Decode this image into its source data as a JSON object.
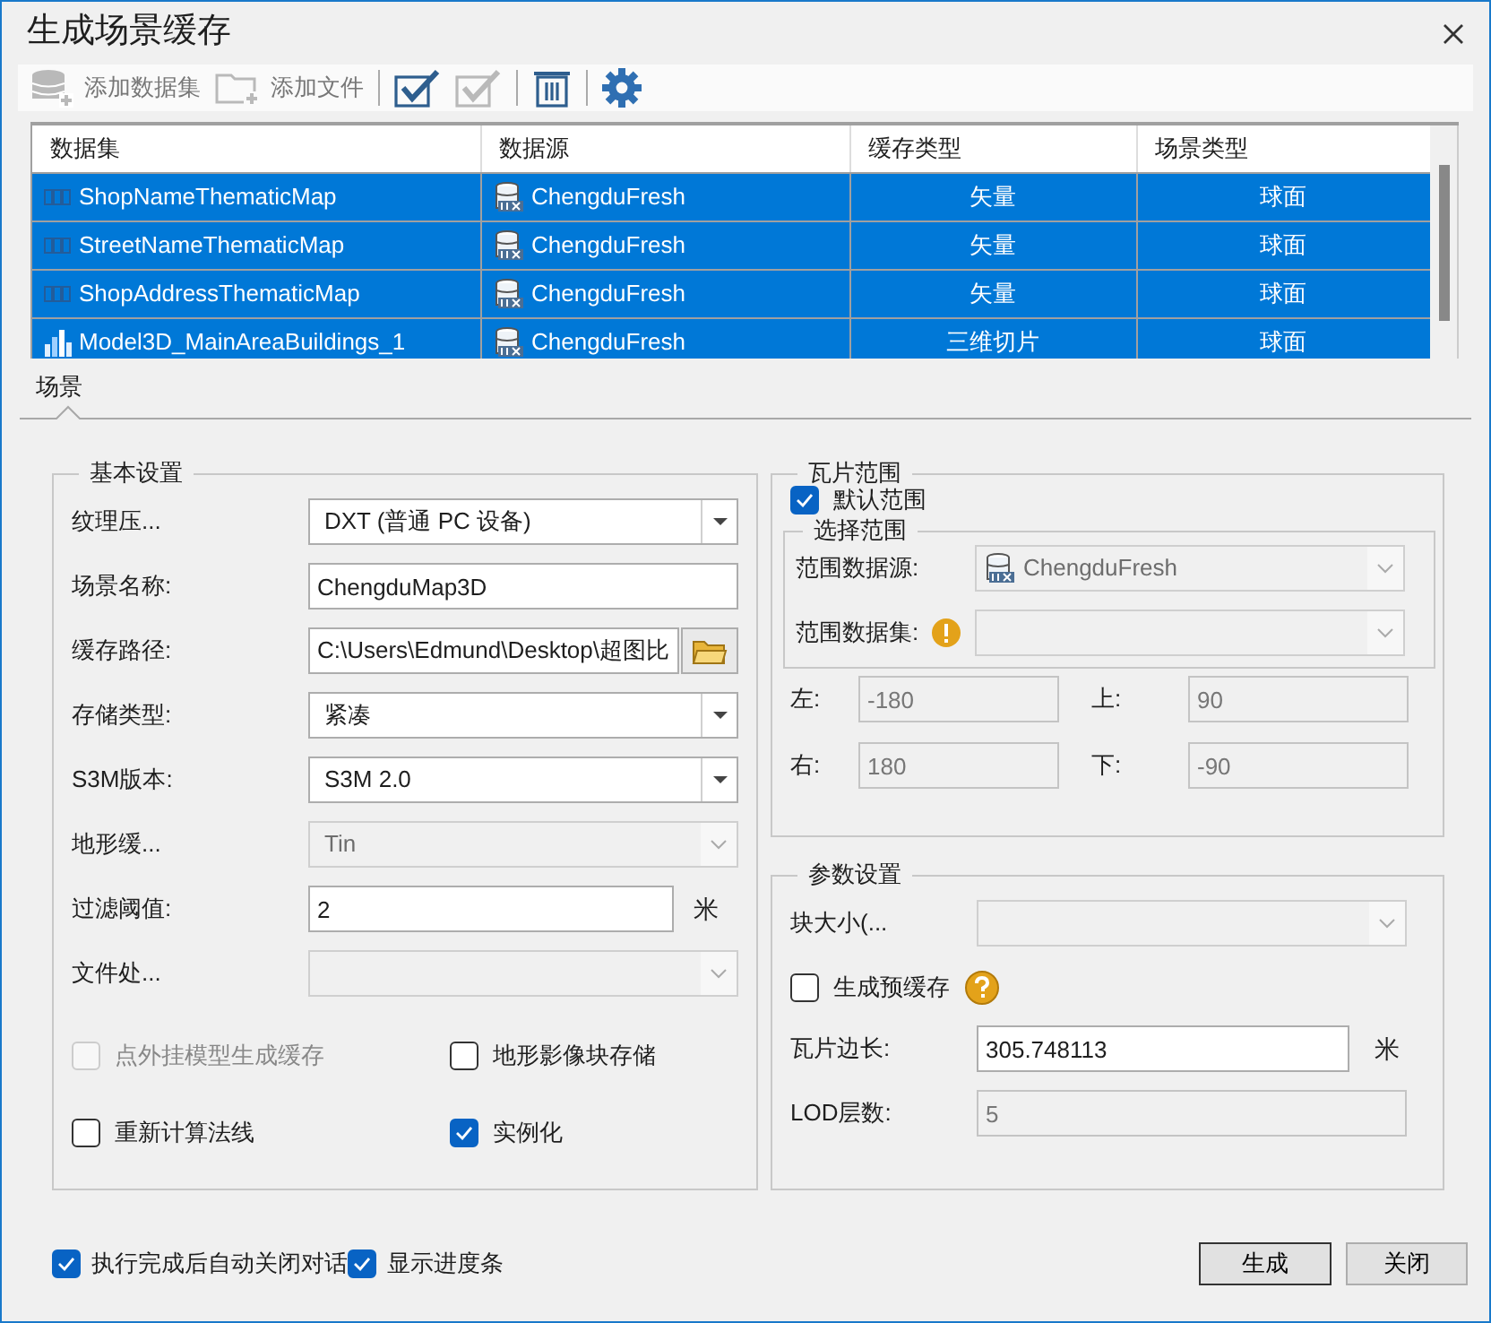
{
  "window": {
    "title": "生成场景缓存"
  },
  "toolbar": [
    {
      "kind": "add-dataset",
      "label": "添加数据集",
      "disabled": true
    },
    {
      "kind": "add-file",
      "label": "添加文件",
      "disabled": true
    },
    {
      "kind": "select-all",
      "disabled": false
    },
    {
      "kind": "select-none",
      "disabled": true
    },
    {
      "kind": "delete",
      "disabled": false
    },
    {
      "kind": "settings",
      "disabled": false
    }
  ],
  "table": {
    "columns": [
      "数据集",
      "数据源",
      "缓存类型",
      "场景类型"
    ],
    "rows": [
      {
        "dataset": "ShopNameThematicMap",
        "kind": "cad",
        "source": "ChengduFresh",
        "cache_type": "矢量",
        "scene_type": "球面",
        "selected": true
      },
      {
        "dataset": "StreetNameThematicMap",
        "kind": "cad",
        "source": "ChengduFresh",
        "cache_type": "矢量",
        "scene_type": "球面",
        "selected": true
      },
      {
        "dataset": "ShopAddressThematicMap",
        "kind": "cad",
        "source": "ChengduFresh",
        "cache_type": "矢量",
        "scene_type": "球面",
        "selected": true
      },
      {
        "dataset": "Model3D_MainAreaBuildings_1",
        "kind": "model",
        "source": "ChengduFresh",
        "cache_type": "三维切片",
        "scene_type": "球面",
        "selected": true
      }
    ]
  },
  "tabs": [
    {
      "label": "场景",
      "selected": true
    }
  ],
  "basic_settings": {
    "title": "基本设置",
    "fields": [
      {
        "kind": "dropdown",
        "label": "纹理压...",
        "value": "DXT (普通 PC 设备)",
        "disabled": false
      },
      {
        "kind": "text",
        "label": "场景名称:",
        "value": "ChengduMap3D",
        "disabled": false
      },
      {
        "kind": "path",
        "label": "缓存路径:",
        "value": "C:\\Users\\Edmund\\Desktop\\超图比",
        "disabled": false
      },
      {
        "kind": "dropdown",
        "label": "存储类型:",
        "value": "紧凑",
        "disabled": false
      },
      {
        "kind": "dropdown",
        "label": "S3M版本:",
        "value": "S3M 2.0",
        "disabled": false
      },
      {
        "kind": "dropdown",
        "label": "地形缓...",
        "value": "Tin",
        "disabled": true
      },
      {
        "kind": "text",
        "label": "过滤阈值:",
        "value": "2",
        "unit": "米",
        "disabled": false
      },
      {
        "kind": "dropdown",
        "label": "文件处...",
        "disabled": true
      }
    ],
    "checkboxes": [
      {
        "label": "点外挂模型生成缓存",
        "checked": false,
        "disabled": true
      },
      {
        "label": "地形影像块存储",
        "checked": false,
        "disabled": false
      },
      {
        "label": "重新计算法线",
        "checked": false,
        "disabled": false
      },
      {
        "label": "实例化",
        "checked": true,
        "disabled": false
      }
    ]
  },
  "tile_range": {
    "title": "瓦片范围",
    "default_range": {
      "label": "默认范围",
      "checked": true
    },
    "select_range": {
      "title": "选择范围",
      "fields": [
        {
          "kind": "dropdown",
          "label": "范围数据源:",
          "value": "ChengduFresh",
          "source_icon": true,
          "disabled": true
        },
        {
          "kind": "dropdown",
          "label": "范围数据集:",
          "warning": true,
          "disabled": true
        }
      ]
    },
    "bounds": [
      {
        "label": "左:",
        "value": "-180",
        "disabled": true
      },
      {
        "label": "上:",
        "value": "90",
        "disabled": true
      },
      {
        "label": "右:",
        "value": "180",
        "disabled": true
      },
      {
        "label": "下:",
        "value": "-90",
        "disabled": true
      }
    ]
  },
  "parameters": {
    "title": "参数设置",
    "block_size": {
      "kind": "dropdown",
      "label": "块大小(...",
      "disabled": true
    },
    "precache": {
      "label": "生成预缓存",
      "checked": false,
      "help": true
    },
    "tile_length": {
      "kind": "text",
      "label": "瓦片边长:",
      "value": "305.748113",
      "unit": "米",
      "disabled": false
    },
    "lod": {
      "kind": "text",
      "label": "LOD层数:",
      "value": "5",
      "disabled": true
    }
  },
  "footer": {
    "checkboxes": [
      {
        "label": "执行完成后自动关闭对话",
        "checked": true
      },
      {
        "label": "显示进度条",
        "checked": true
      }
    ],
    "buttons": [
      {
        "label": "生成",
        "default": true
      },
      {
        "label": "关闭",
        "default": false
      }
    ]
  }
}
